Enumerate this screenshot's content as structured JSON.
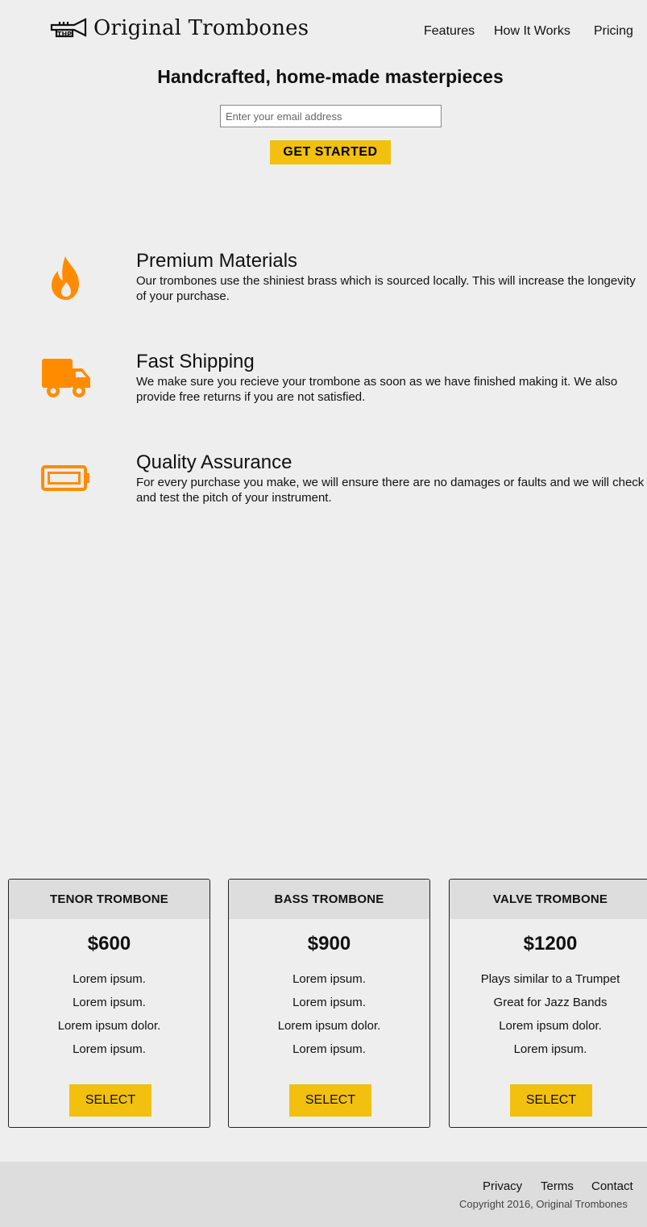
{
  "header": {
    "brand": "Original Trombones",
    "nav": [
      "Features",
      "How It Works",
      "Pricing"
    ]
  },
  "hero": {
    "title": "Handcrafted, home-made masterpieces",
    "email_placeholder": "Enter your email address",
    "cta_label": "GET STARTED"
  },
  "features": [
    {
      "icon": "fire-icon",
      "title": "Premium Materials",
      "text": "Our trombones use the shiniest brass which is sourced locally. This will increase the longevity of your purchase."
    },
    {
      "icon": "truck-icon",
      "title": "Fast Shipping",
      "text": "We make sure you recieve your trombone as soon as we have finished making it. We also provide free returns if you are not satisfied."
    },
    {
      "icon": "battery-icon",
      "title": "Quality Assurance",
      "text": "For every purchase you make, we will ensure there are no damages or faults and we will check and test the pitch of your instrument."
    }
  ],
  "pricing": [
    {
      "name": "TENOR TROMBONE",
      "price": "$600",
      "items": [
        "Lorem ipsum.",
        "Lorem ipsum.",
        "Lorem ipsum dolor.",
        "Lorem ipsum."
      ],
      "button": "SELECT"
    },
    {
      "name": "BASS TROMBONE",
      "price": "$900",
      "items": [
        "Lorem ipsum.",
        "Lorem ipsum.",
        "Lorem ipsum dolor.",
        "Lorem ipsum."
      ],
      "button": "SELECT"
    },
    {
      "name": "VALVE TROMBONE",
      "price": "$1200",
      "items": [
        "Plays similar to a Trumpet",
        "Great for Jazz Bands",
        "Lorem ipsum dolor.",
        "Lorem ipsum."
      ],
      "button": "SELECT"
    }
  ],
  "footer": {
    "links": [
      "Privacy",
      "Terms",
      "Contact"
    ],
    "copyright": "Copyright 2016, Original Trombones"
  },
  "colors": {
    "accent": "#f2c00f",
    "icon": "#ff8c00",
    "background": "#eeeeee"
  }
}
